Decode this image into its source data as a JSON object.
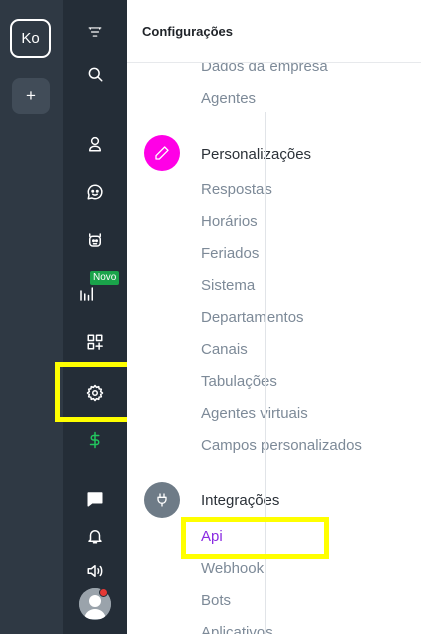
{
  "workspace": {
    "avatar_initials": "Ko",
    "add_label": "+"
  },
  "nav": {
    "new_badge": "Novo",
    "icons": [
      "menu-icon",
      "search-icon",
      "contacts-icon",
      "chat-bot-icon",
      "robot-icon",
      "reports-icon",
      "apps-add-icon",
      "gear-icon",
      "dollar-icon",
      "message-icon",
      "bell-icon",
      "speaker-icon"
    ]
  },
  "header": {
    "title": "Configurações"
  },
  "settings": {
    "top_items": [
      "Dados da empresa",
      "Agentes"
    ],
    "personalizacoes": {
      "title": "Personalizações",
      "icon": "pencil-icon",
      "color": "#ff00e6",
      "items": [
        "Respostas",
        "Horários",
        "Feriados",
        "Sistema",
        "Departamentos",
        "Canais",
        "Tabulações",
        "Agentes virtuais",
        "Campos personalizados"
      ]
    },
    "integracoes": {
      "title": "Integrações",
      "icon": "plug-icon",
      "color": "#6e7b87",
      "items": [
        "Api",
        "Webhook",
        "Bots",
        "Aplicativos"
      ],
      "active_item": "Api"
    }
  },
  "colors": {
    "highlight": "#ffff00",
    "active_item": "#8a2be2",
    "novo_badge": "#1aa34a",
    "dollar": "#22c55e"
  }
}
